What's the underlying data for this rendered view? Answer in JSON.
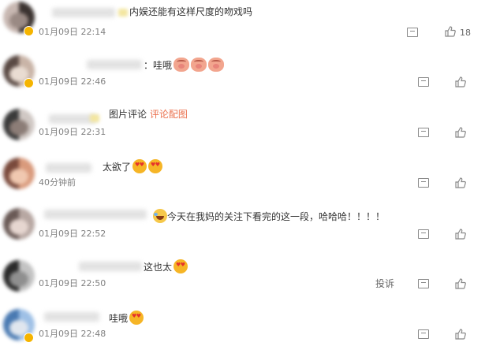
{
  "comments": [
    {
      "text": "内娱还能有这样尺度的吻戏吗",
      "time": "01月09日 22:14",
      "likes": "18",
      "avatar": [
        "#c8b8b2",
        "#3b3330",
        "#9a8a84"
      ]
    },
    {
      "text": "：哇哦",
      "time": "01月09日 22:46",
      "avatar": [
        "#5a4a44",
        "#c9b4a7",
        "#e9dcd2"
      ]
    },
    {
      "text": "图片评论",
      "link": "评论配图",
      "time": "01月09日 22:31",
      "avatar": [
        "#3a3a3a",
        "#d0c8c4",
        "#8c7d77"
      ]
    },
    {
      "text": "太欲了",
      "time": "40分钟前",
      "avatar": [
        "#7a4a3c",
        "#d99a7c",
        "#f0c8b0"
      ]
    },
    {
      "text": "今天在我妈的关注下看完的这一段，哈哈哈！！！！",
      "time": "01月09日 22:52",
      "avatar": [
        "#6a5a56",
        "#b7a7a2",
        "#e6d6d0"
      ]
    },
    {
      "text": "这也太",
      "time": "01月09日 22:50",
      "report": "投诉",
      "avatar": [
        "#2a2a2a",
        "#c3c3c3",
        "#8f8f8f"
      ]
    },
    {
      "text": "哇哦",
      "time": "01月09日 22:48",
      "avatar": [
        "#4a7ab2",
        "#9ec0e6",
        "#e0e6ee"
      ]
    }
  ],
  "icons": {
    "comment": "comment-icon",
    "like": "thumbs-up-icon",
    "emoji_love": "heart-eyes-emoji",
    "emoji_laugh": "laugh-cry-emoji",
    "emoji_pig": "pig-emoji"
  }
}
